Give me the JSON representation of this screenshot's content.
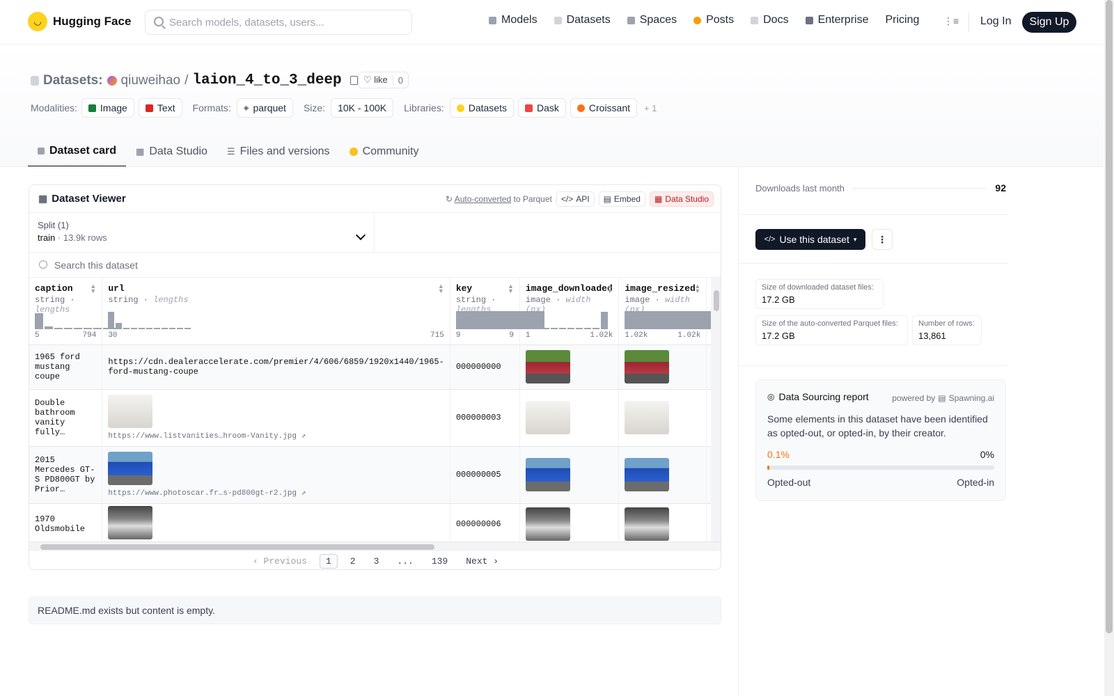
{
  "nav": {
    "brand": "Hugging Face",
    "search_placeholder": "Search models, datasets, users...",
    "items": [
      {
        "label": "Models",
        "color": "#9ca3af"
      },
      {
        "label": "Datasets",
        "color": "#d1d5db"
      },
      {
        "label": "Spaces",
        "color": "#9ca3af"
      },
      {
        "label": "Posts",
        "color": "#f59e0b"
      },
      {
        "label": "Docs",
        "color": "#d1d5db"
      },
      {
        "label": "Enterprise",
        "color": "#6b7280"
      },
      {
        "label": "Pricing",
        "color": ""
      }
    ],
    "login": "Log In",
    "signup": "Sign Up"
  },
  "header": {
    "section": "Datasets:",
    "owner": "qiuweihao",
    "separator": "/",
    "name": "laion_4_to_3_deep",
    "like_label": "like",
    "like_count": "0",
    "modalities_label": "Modalities:",
    "modalities": [
      "Image",
      "Text"
    ],
    "formats_label": "Formats:",
    "format": "parquet",
    "size_label": "Size:",
    "size": "10K - 100K",
    "libraries_label": "Libraries:",
    "libraries": [
      "Datasets",
      "Dask",
      "Croissant"
    ],
    "libraries_more": "+ 1"
  },
  "tabs": [
    "Dataset card",
    "Data Studio",
    "Files and versions",
    "Community"
  ],
  "viewer": {
    "title": "Dataset Viewer",
    "auto_converted": "Auto-converted",
    "to_parquet": "to Parquet",
    "api": "API",
    "embed": "Embed",
    "data_studio": "Data Studio",
    "split_label": "Split (1)",
    "split_name": "train",
    "split_rows": "13.9k rows",
    "search_placeholder": "Search this dataset",
    "columns": [
      {
        "name": "caption",
        "type": "string",
        "sub": "lengths",
        "min": "5",
        "max": "794",
        "hist": [
          0.9,
          0.15,
          0.05,
          0.05,
          0.05,
          0.05,
          0,
          0.05,
          0.05
        ]
      },
      {
        "name": "url",
        "type": "string",
        "sub": "lengths",
        "min": "30",
        "max": "715",
        "hist": [
          0.95,
          0.35,
          0.05,
          0.05,
          0.05,
          0.05,
          0.05,
          0,
          0,
          0,
          0.05
        ]
      },
      {
        "name": "key",
        "type": "string",
        "sub": "lengths",
        "min": "9",
        "max": "9",
        "hist": [
          1
        ]
      },
      {
        "name": "image_downloaded",
        "type": "image",
        "sub": "width (px)",
        "min": "1",
        "max": "1.02k",
        "hist": [
          0.05,
          0.05,
          0.05,
          0.05,
          0.05,
          0,
          0,
          0.05,
          0.05,
          0.95
        ]
      },
      {
        "name": "image_resized",
        "type": "image",
        "sub": "width (px)",
        "min": "1.02k",
        "max": "1.02k",
        "hist": [
          1
        ]
      }
    ],
    "rows": [
      {
        "caption": "1965 ford mustang coupe",
        "url": "https://cdn.dealeraccelerate.com/premier/4/606/6859/1920x1440/1965-ford-mustang-coupe",
        "url_short": "",
        "key": "000000000",
        "img": "car1",
        "url_img": false
      },
      {
        "caption": "Double bathroom vanity fully…",
        "url": "",
        "url_short": "https://www.listvanities…hroom-Vanity.jpg ↗",
        "key": "000000003",
        "img": "car2",
        "url_img": true
      },
      {
        "caption": "2015 Mercedes GT-S PD800GT by Prior…",
        "url": "",
        "url_short": "https://www.photoscar.fr…s-pd800gt-r2.jpg ↗",
        "key": "000000005",
        "img": "car3",
        "url_img": true
      },
      {
        "caption": "1970 Oldsmobile",
        "url": "",
        "url_short": "",
        "key": "000000006",
        "img": "car4",
        "url_img": true
      }
    ],
    "pager": {
      "prev": "Previous",
      "pages": [
        "1",
        "2",
        "3",
        "...",
        "139"
      ],
      "next": "Next"
    }
  },
  "readme": "README.md exists but content is empty.",
  "sidebar": {
    "downloads_label": "Downloads last month",
    "downloads": "92",
    "use_dataset": "Use this dataset",
    "stats": [
      {
        "label": "Size of downloaded dataset files:",
        "value": "17.2 GB"
      },
      {
        "label": "Size of the auto-converted Parquet files:",
        "value": "17.2 GB"
      },
      {
        "label": "Number of rows:",
        "value": "13,861"
      }
    ],
    "report": {
      "title": "Data Sourcing report",
      "powered_by": "powered by",
      "provider": "Spawning.ai",
      "text": "Some elements in this dataset have been identified as opted-out, or opted-in, by their creator.",
      "opted_out_pct": "0.1%",
      "opted_in_pct": "0%",
      "opted_out_fraction": 0.001,
      "opted_out_label": "Opted-out",
      "opted_in_label": "Opted-in"
    }
  }
}
